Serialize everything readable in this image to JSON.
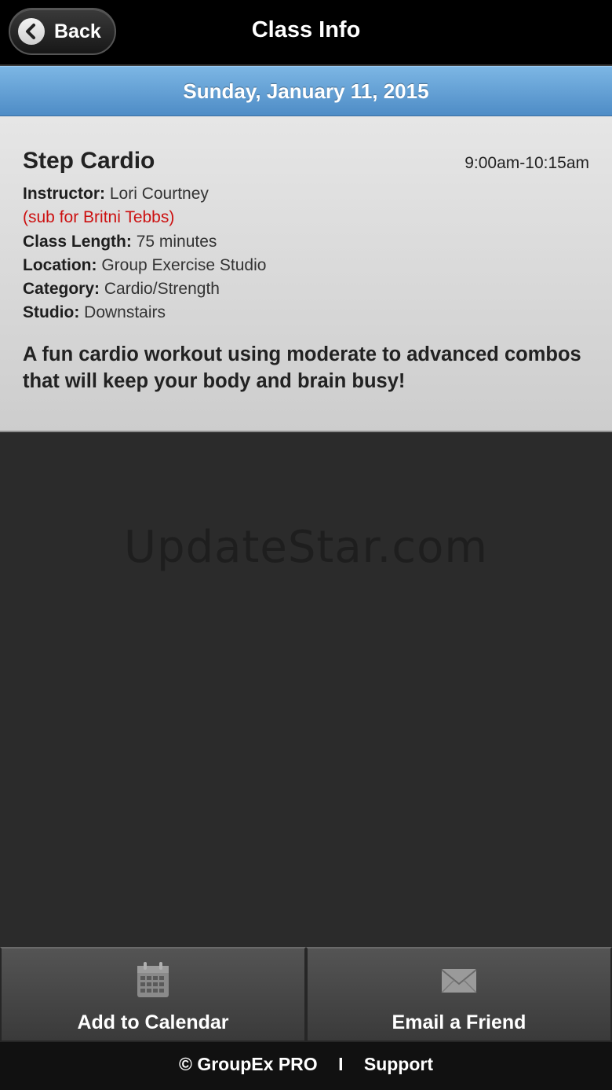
{
  "header": {
    "back_label": "Back",
    "title": "Class Info"
  },
  "date_bar": {
    "date": "Sunday, January 11, 2015"
  },
  "class_info": {
    "name": "Step Cardio",
    "time": "9:00am-10:15am",
    "instructor_label": "Instructor:",
    "instructor": "Lori Courtney",
    "sub_note": "(sub for Britni Tebbs)",
    "length_label": "Class Length:",
    "length": "75 minutes",
    "location_label": "Location:",
    "location": "Group Exercise Studio",
    "category_label": "Category:",
    "category": "Cardio/Strength",
    "studio_label": "Studio:",
    "studio": "Downstairs",
    "description": "A fun cardio workout using moderate to advanced combos that will keep your body and brain busy!"
  },
  "watermark": "UpdateStar.com",
  "actions": {
    "calendar_label": "Add to Calendar",
    "calendar_icon": "calendar-icon",
    "email_label": "Email a Friend",
    "email_icon": "envelope-icon"
  },
  "footer": {
    "copyright": "© GroupEx PRO",
    "separator": "I",
    "support": "Support"
  },
  "colors": {
    "date_bar": "#5b9bd5",
    "sub_note": "#cc1010",
    "background": "#2b2b2b"
  }
}
